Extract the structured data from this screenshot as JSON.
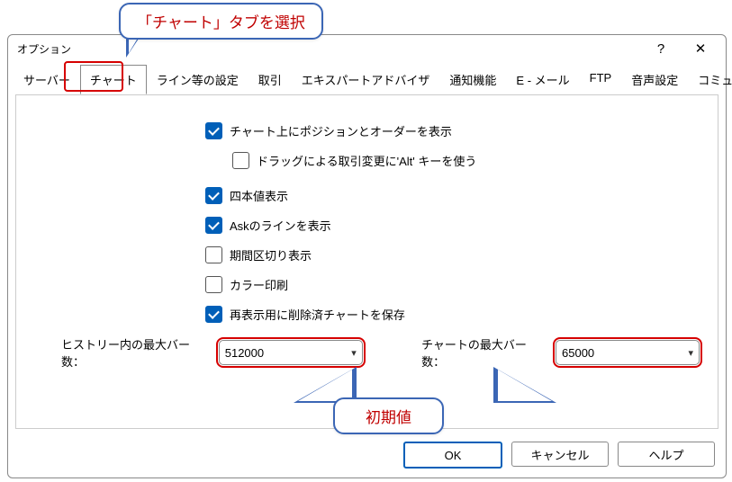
{
  "annotations": {
    "top_callout": "「チャート」タブを選択",
    "bottom_callout": "初期値"
  },
  "dialog": {
    "title": "オプション",
    "help_symbol": "?",
    "close_symbol": "✕"
  },
  "tabs": {
    "items": [
      "サーバー",
      "チャート",
      "ライン等の設定",
      "取引",
      "エキスパートアドバイザ",
      "通知機能",
      "E - メール",
      "FTP",
      "音声設定",
      "コミュニティ"
    ],
    "active_index": 1
  },
  "options": {
    "show_positions_orders": {
      "label": "チャート上にポジションとオーダーを表示",
      "checked": true
    },
    "drag_trade_alt": {
      "label": "ドラッグによる取引変更に'Alt' キーを使う",
      "checked": false
    },
    "show_ohlc": {
      "label": "四本値表示",
      "checked": true
    },
    "show_ask_line": {
      "label": "Askのラインを表示",
      "checked": true
    },
    "show_period_separators": {
      "label": "期間区切り表示",
      "checked": false
    },
    "color_print": {
      "label": "カラー印刷",
      "checked": false
    },
    "save_deleted_charts": {
      "label": "再表示用に削除済チャートを保存",
      "checked": true
    }
  },
  "combos": {
    "history_max_bars": {
      "label": "ヒストリー内の最大バー数：",
      "value": "512000"
    },
    "chart_max_bars": {
      "label": "チャートの最大バー数：",
      "value": "65000"
    }
  },
  "buttons": {
    "ok": "OK",
    "cancel": "キャンセル",
    "help": "ヘルプ"
  }
}
